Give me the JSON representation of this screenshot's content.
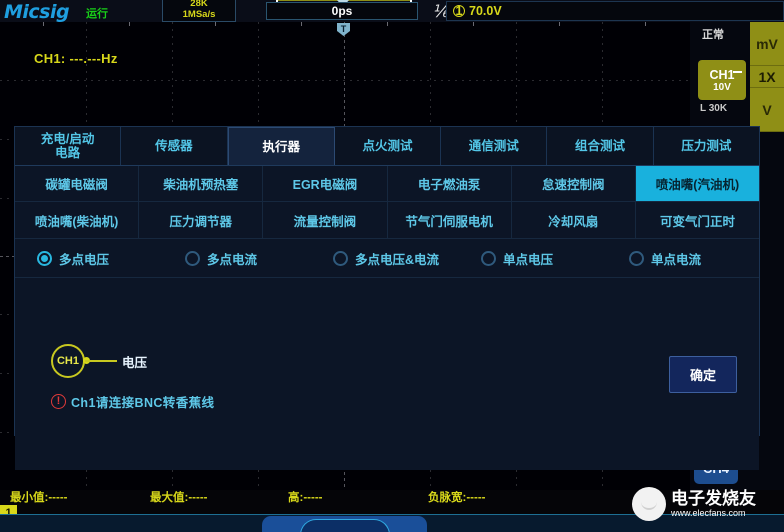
{
  "topbar": {
    "brand": "Micsig",
    "run_state": "运行",
    "acq_depth": "28K",
    "sample_rate": "1MSa/s",
    "trigger_position": "0ps",
    "trigger_slope_icon": "rising-edge-icon",
    "trigger_channel": "1",
    "trigger_level": "70.0V",
    "left_arrow_icon": "arrow-left-icon",
    "right_arrow_icon": "arrow-right-icon",
    "trigger_marker": "T"
  },
  "graticule": {
    "ch1_measurement": "CH1: ---.---Hz",
    "trigger_marker_label": "T"
  },
  "right_panel": {
    "trigger_mode": "正常",
    "channel_button": {
      "name": "CH1",
      "scale": "10V",
      "coupling_icon": "dc-coupling-icon"
    },
    "channel_sub": "L 30K",
    "units": [
      "mV",
      "1X",
      "V"
    ],
    "ch4_button": "CH4"
  },
  "dialog": {
    "tabs": [
      {
        "label": "充电/启动\n电路",
        "line1": "充电/启动",
        "line2": "电路",
        "active": false
      },
      {
        "label": "传感器",
        "line1": "传感器",
        "line2": "",
        "active": false
      },
      {
        "label": "执行器",
        "line1": "执行器",
        "line2": "",
        "active": true
      },
      {
        "label": "点火测试",
        "line1": "点火测试",
        "line2": "",
        "active": false
      },
      {
        "label": "通信测试",
        "line1": "通信测试",
        "line2": "",
        "active": false
      },
      {
        "label": "组合测试",
        "line1": "组合测试",
        "line2": "",
        "active": false
      },
      {
        "label": "压力测试",
        "line1": "压力测试",
        "line2": "",
        "active": false
      }
    ],
    "grid": [
      [
        {
          "label": "碳罐电磁阀",
          "selected": false
        },
        {
          "label": "柴油机预热塞",
          "selected": false
        },
        {
          "label": "EGR电磁阀",
          "selected": false
        },
        {
          "label": "电子燃油泵",
          "selected": false
        },
        {
          "label": "怠速控制阀",
          "selected": false
        },
        {
          "label": "喷油嘴(汽油机)",
          "selected": true
        }
      ],
      [
        {
          "label": "喷油嘴(柴油机)",
          "selected": false
        },
        {
          "label": "压力调节器",
          "selected": false
        },
        {
          "label": "流量控制阀",
          "selected": false
        },
        {
          "label": "节气门伺服电机",
          "selected": false
        },
        {
          "label": "冷却风扇",
          "selected": false
        },
        {
          "label": "可变气门正时",
          "selected": false
        }
      ]
    ],
    "radios": [
      {
        "label": "多点电压",
        "selected": true
      },
      {
        "label": "多点电流",
        "selected": false
      },
      {
        "label": "多点电压&电流",
        "selected": false
      },
      {
        "label": "单点电压",
        "selected": false
      },
      {
        "label": "单点电流",
        "selected": false
      }
    ],
    "diagram": {
      "node_label": "CH1",
      "lead_label": "电压"
    },
    "warning": {
      "icon": "exclamation-circle-icon",
      "glyph": "!",
      "text": "Ch1请连接BNC转香蕉线"
    },
    "confirm_button": "确定"
  },
  "measurements": [
    {
      "label": "最小值:",
      "value": "-----"
    },
    {
      "label": "最大值:",
      "value": "-----"
    },
    {
      "label": "高:",
      "value": "-----"
    },
    {
      "label": "负脉宽:",
      "value": "-----"
    }
  ],
  "channel_marker": "1",
  "watermark": {
    "title": "电子发烧友",
    "url": "www.elecfans.com"
  },
  "colors": {
    "accent_cyan": "#19b1dd",
    "label_cyan": "#5ec8e8",
    "yellow": "#d8d81a",
    "brand_blue": "#1f9fe0",
    "run_green": "#18d018",
    "warn_red": "#e03a3a",
    "dialog_bg": "#0c1526"
  }
}
